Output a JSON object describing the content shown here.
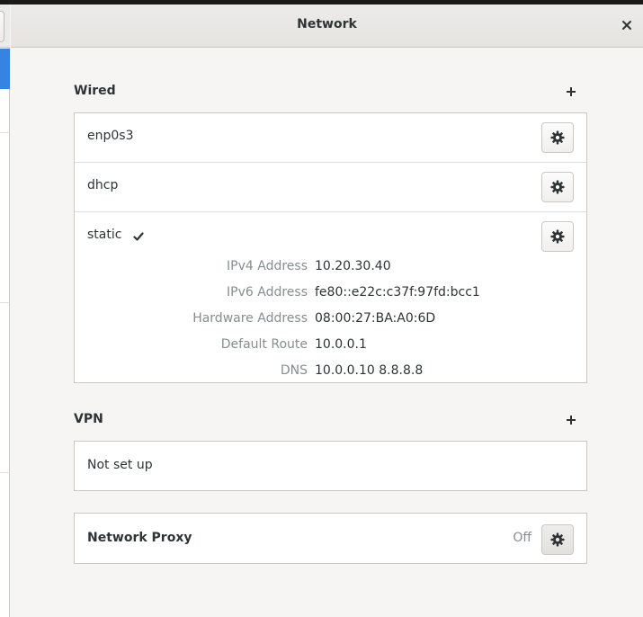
{
  "window": {
    "title": "Network"
  },
  "wired": {
    "title": "Wired",
    "connections": [
      {
        "label": "enp0s3"
      },
      {
        "label": "dhcp"
      },
      {
        "label": "static",
        "active": true
      }
    ],
    "details": [
      {
        "key": "IPv4 Address",
        "value": "10.20.30.40"
      },
      {
        "key": "IPv6 Address",
        "value": "fe80::e22c:c37f:97fd:bcc1"
      },
      {
        "key": "Hardware Address",
        "value": "08:00:27:BA:A0:6D"
      },
      {
        "key": "Default Route",
        "value": "10.0.0.1"
      },
      {
        "key": "DNS",
        "value": "10.0.0.10 8.8.8.8"
      }
    ]
  },
  "vpn": {
    "title": "VPN",
    "empty_label": "Not set up"
  },
  "proxy": {
    "label": "Network Proxy",
    "status": "Off"
  },
  "icons": {
    "close": "close-icon",
    "add": "plus-icon",
    "settings": "gear-icon",
    "active": "checkmark-icon"
  },
  "colors": {
    "accent": "#3584e4"
  }
}
